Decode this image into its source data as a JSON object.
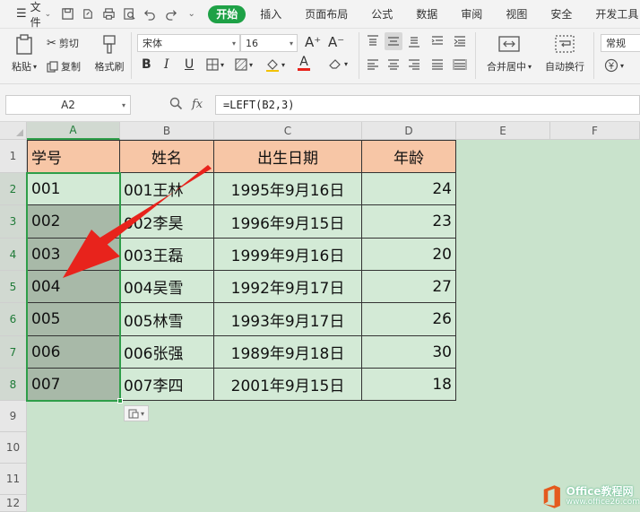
{
  "menubar": {
    "file_label": "文件",
    "tabs": [
      "开始",
      "插入",
      "页面布局",
      "公式",
      "数据",
      "审阅",
      "视图",
      "安全",
      "开发工具"
    ],
    "active_tab": "开始"
  },
  "ribbon": {
    "paste_label": "粘贴",
    "cut_label": "剪切",
    "copy_label": "复制",
    "format_painter_label": "格式刷",
    "font_name": "宋体",
    "font_size": "16",
    "bold": "B",
    "italic": "I",
    "underline": "U",
    "merge_center_label": "合并居中",
    "wrap_text_label": "自动换行",
    "number_format": "常规"
  },
  "formula_bar": {
    "cell_ref": "A2",
    "fx_label": "fx",
    "formula": "=LEFT(B2,3)"
  },
  "columns": [
    "A",
    "B",
    "C",
    "D",
    "E",
    "F"
  ],
  "rows": [
    "1",
    "2",
    "3",
    "4",
    "5",
    "6",
    "7",
    "8",
    "9",
    "10",
    "11",
    "12"
  ],
  "table": {
    "headers": [
      "学号",
      "姓名",
      "出生日期",
      "年龄"
    ],
    "data": [
      [
        "001",
        "001王林",
        "1995年9月16日",
        "24"
      ],
      [
        "002",
        "002李昊",
        "1996年9月15日",
        "23"
      ],
      [
        "003",
        "003王磊",
        "1999年9月16日",
        "20"
      ],
      [
        "004",
        "004吴雪",
        "1992年9月17日",
        "27"
      ],
      [
        "005",
        "005林雪",
        "1993年9月17日",
        "26"
      ],
      [
        "006",
        "006张强",
        "1989年9月18日",
        "30"
      ],
      [
        "007",
        "007李四",
        "2001年9月15日",
        "18"
      ]
    ]
  },
  "watermark": {
    "title": "Office教程网",
    "url": "www.office26.com"
  },
  "colors": {
    "accent": "#1ea146",
    "header_fill": "#f7c6a6",
    "body_fill": "#d3ead6",
    "selection": "#2e9e49",
    "arrow": "#e8231c"
  }
}
